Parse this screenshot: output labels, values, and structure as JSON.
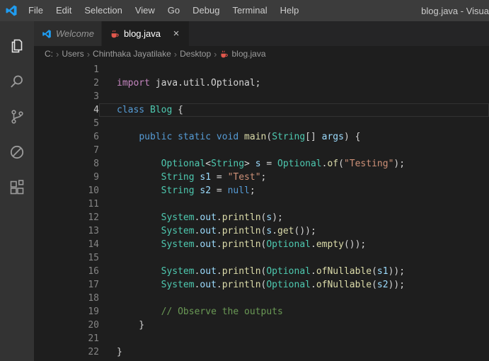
{
  "palette": {
    "titlebar_bg": "#3c3c3c",
    "activitybar_bg": "#333333",
    "tabbar_bg": "#252526",
    "editor_bg": "#1e1e1e",
    "vscode_logo_blue": "#1f9cf0",
    "keyword_pink": "#c586c0",
    "keyword_blue": "#569cd6",
    "type_teal": "#4ec9b0",
    "function_yellow": "#dcdcaa",
    "variable_blue": "#9cdcfe",
    "string_orange": "#ce9178",
    "comment_green": "#6a9955",
    "java_icon_color": "#e2574c"
  },
  "title_bar": {
    "app_logo": "vscode-logo-icon",
    "menus": [
      "File",
      "Edit",
      "Selection",
      "View",
      "Go",
      "Debug",
      "Terminal",
      "Help"
    ],
    "window_title": "blog.java - Visua"
  },
  "activity_bar": {
    "items": [
      {
        "label": "Explorer",
        "icon": "files-icon"
      },
      {
        "label": "Search",
        "icon": "search-icon"
      },
      {
        "label": "Source Control",
        "icon": "source-control-icon"
      },
      {
        "label": "Debug",
        "icon": "debug-icon"
      },
      {
        "label": "Extensions",
        "icon": "extensions-icon"
      }
    ]
  },
  "tab_bar": {
    "tabs": [
      {
        "label": "Welcome",
        "icon": "vscode-logo-icon",
        "active": false,
        "italic": true
      },
      {
        "label": "blog.java",
        "icon": "java-file-icon",
        "active": true,
        "italic": false,
        "close_label": "×"
      }
    ]
  },
  "breadcrumb": {
    "separator": "›",
    "items": [
      {
        "label": "C:"
      },
      {
        "label": "Users"
      },
      {
        "label": "Chinthaka Jayatilake"
      },
      {
        "label": "Desktop"
      },
      {
        "label": "blog.java",
        "icon": "java-file-icon"
      }
    ]
  },
  "editor": {
    "language": "java",
    "lines": [
      {
        "num": 1,
        "tokens": []
      },
      {
        "num": 2,
        "tokens": [
          {
            "t": "import",
            "c": "kw"
          },
          {
            "t": " java.util.Optional;",
            "c": "pl"
          }
        ]
      },
      {
        "num": 3,
        "tokens": []
      },
      {
        "num": 4,
        "current": true,
        "tokens": [
          {
            "t": "class",
            "c": "kwb"
          },
          {
            "t": " ",
            "c": "pl"
          },
          {
            "t": "Blog",
            "c": "type"
          },
          {
            "t": " {",
            "c": "pl"
          }
        ]
      },
      {
        "num": 5,
        "tokens": []
      },
      {
        "num": 6,
        "tokens": [
          {
            "t": "    ",
            "c": "pl"
          },
          {
            "t": "public",
            "c": "kwb"
          },
          {
            "t": " ",
            "c": "pl"
          },
          {
            "t": "static",
            "c": "kwb"
          },
          {
            "t": " ",
            "c": "pl"
          },
          {
            "t": "void",
            "c": "kwb"
          },
          {
            "t": " ",
            "c": "pl"
          },
          {
            "t": "main",
            "c": "fn"
          },
          {
            "t": "(",
            "c": "pl"
          },
          {
            "t": "String",
            "c": "type"
          },
          {
            "t": "[] ",
            "c": "pl"
          },
          {
            "t": "args",
            "c": "var"
          },
          {
            "t": ") {",
            "c": "pl"
          }
        ]
      },
      {
        "num": 7,
        "tokens": []
      },
      {
        "num": 8,
        "tokens": [
          {
            "t": "        ",
            "c": "pl"
          },
          {
            "t": "Optional",
            "c": "type"
          },
          {
            "t": "<",
            "c": "pl"
          },
          {
            "t": "String",
            "c": "type"
          },
          {
            "t": "> ",
            "c": "pl"
          },
          {
            "t": "s",
            "c": "var"
          },
          {
            "t": " = ",
            "c": "pl"
          },
          {
            "t": "Optional",
            "c": "type"
          },
          {
            "t": ".",
            "c": "pl"
          },
          {
            "t": "of",
            "c": "fn"
          },
          {
            "t": "(",
            "c": "pl"
          },
          {
            "t": "\"Testing\"",
            "c": "str"
          },
          {
            "t": ");",
            "c": "pl"
          }
        ]
      },
      {
        "num": 9,
        "tokens": [
          {
            "t": "        ",
            "c": "pl"
          },
          {
            "t": "String",
            "c": "type"
          },
          {
            "t": " ",
            "c": "pl"
          },
          {
            "t": "s1",
            "c": "var"
          },
          {
            "t": " = ",
            "c": "pl"
          },
          {
            "t": "\"Test\"",
            "c": "str"
          },
          {
            "t": ";",
            "c": "pl"
          }
        ]
      },
      {
        "num": 10,
        "tokens": [
          {
            "t": "        ",
            "c": "pl"
          },
          {
            "t": "String",
            "c": "type"
          },
          {
            "t": " ",
            "c": "pl"
          },
          {
            "t": "s2",
            "c": "var"
          },
          {
            "t": " = ",
            "c": "pl"
          },
          {
            "t": "null",
            "c": "kwb"
          },
          {
            "t": ";",
            "c": "pl"
          }
        ]
      },
      {
        "num": 11,
        "tokens": []
      },
      {
        "num": 12,
        "tokens": [
          {
            "t": "        ",
            "c": "pl"
          },
          {
            "t": "System",
            "c": "type"
          },
          {
            "t": ".",
            "c": "pl"
          },
          {
            "t": "out",
            "c": "var"
          },
          {
            "t": ".",
            "c": "pl"
          },
          {
            "t": "println",
            "c": "fn"
          },
          {
            "t": "(",
            "c": "pl"
          },
          {
            "t": "s",
            "c": "var"
          },
          {
            "t": ");",
            "c": "pl"
          }
        ]
      },
      {
        "num": 13,
        "tokens": [
          {
            "t": "        ",
            "c": "pl"
          },
          {
            "t": "System",
            "c": "type"
          },
          {
            "t": ".",
            "c": "pl"
          },
          {
            "t": "out",
            "c": "var"
          },
          {
            "t": ".",
            "c": "pl"
          },
          {
            "t": "println",
            "c": "fn"
          },
          {
            "t": "(",
            "c": "pl"
          },
          {
            "t": "s",
            "c": "var"
          },
          {
            "t": ".",
            "c": "pl"
          },
          {
            "t": "get",
            "c": "fn"
          },
          {
            "t": "());",
            "c": "pl"
          }
        ]
      },
      {
        "num": 14,
        "tokens": [
          {
            "t": "        ",
            "c": "pl"
          },
          {
            "t": "System",
            "c": "type"
          },
          {
            "t": ".",
            "c": "pl"
          },
          {
            "t": "out",
            "c": "var"
          },
          {
            "t": ".",
            "c": "pl"
          },
          {
            "t": "println",
            "c": "fn"
          },
          {
            "t": "(",
            "c": "pl"
          },
          {
            "t": "Optional",
            "c": "type"
          },
          {
            "t": ".",
            "c": "pl"
          },
          {
            "t": "empty",
            "c": "fn"
          },
          {
            "t": "());",
            "c": "pl"
          }
        ]
      },
      {
        "num": 15,
        "tokens": []
      },
      {
        "num": 16,
        "tokens": [
          {
            "t": "        ",
            "c": "pl"
          },
          {
            "t": "System",
            "c": "type"
          },
          {
            "t": ".",
            "c": "pl"
          },
          {
            "t": "out",
            "c": "var"
          },
          {
            "t": ".",
            "c": "pl"
          },
          {
            "t": "println",
            "c": "fn"
          },
          {
            "t": "(",
            "c": "pl"
          },
          {
            "t": "Optional",
            "c": "type"
          },
          {
            "t": ".",
            "c": "pl"
          },
          {
            "t": "ofNullable",
            "c": "fn"
          },
          {
            "t": "(",
            "c": "pl"
          },
          {
            "t": "s1",
            "c": "var"
          },
          {
            "t": "));",
            "c": "pl"
          }
        ]
      },
      {
        "num": 17,
        "tokens": [
          {
            "t": "        ",
            "c": "pl"
          },
          {
            "t": "System",
            "c": "type"
          },
          {
            "t": ".",
            "c": "pl"
          },
          {
            "t": "out",
            "c": "var"
          },
          {
            "t": ".",
            "c": "pl"
          },
          {
            "t": "println",
            "c": "fn"
          },
          {
            "t": "(",
            "c": "pl"
          },
          {
            "t": "Optional",
            "c": "type"
          },
          {
            "t": ".",
            "c": "pl"
          },
          {
            "t": "ofNullable",
            "c": "fn"
          },
          {
            "t": "(",
            "c": "pl"
          },
          {
            "t": "s2",
            "c": "var"
          },
          {
            "t": "));",
            "c": "pl"
          }
        ]
      },
      {
        "num": 18,
        "tokens": []
      },
      {
        "num": 19,
        "tokens": [
          {
            "t": "        ",
            "c": "pl"
          },
          {
            "t": "// Observe the outputs",
            "c": "cm"
          }
        ]
      },
      {
        "num": 20,
        "tokens": [
          {
            "t": "    }",
            "c": "pl"
          }
        ]
      },
      {
        "num": 21,
        "tokens": []
      },
      {
        "num": 22,
        "tokens": [
          {
            "t": "}",
            "c": "pl"
          }
        ]
      }
    ]
  }
}
